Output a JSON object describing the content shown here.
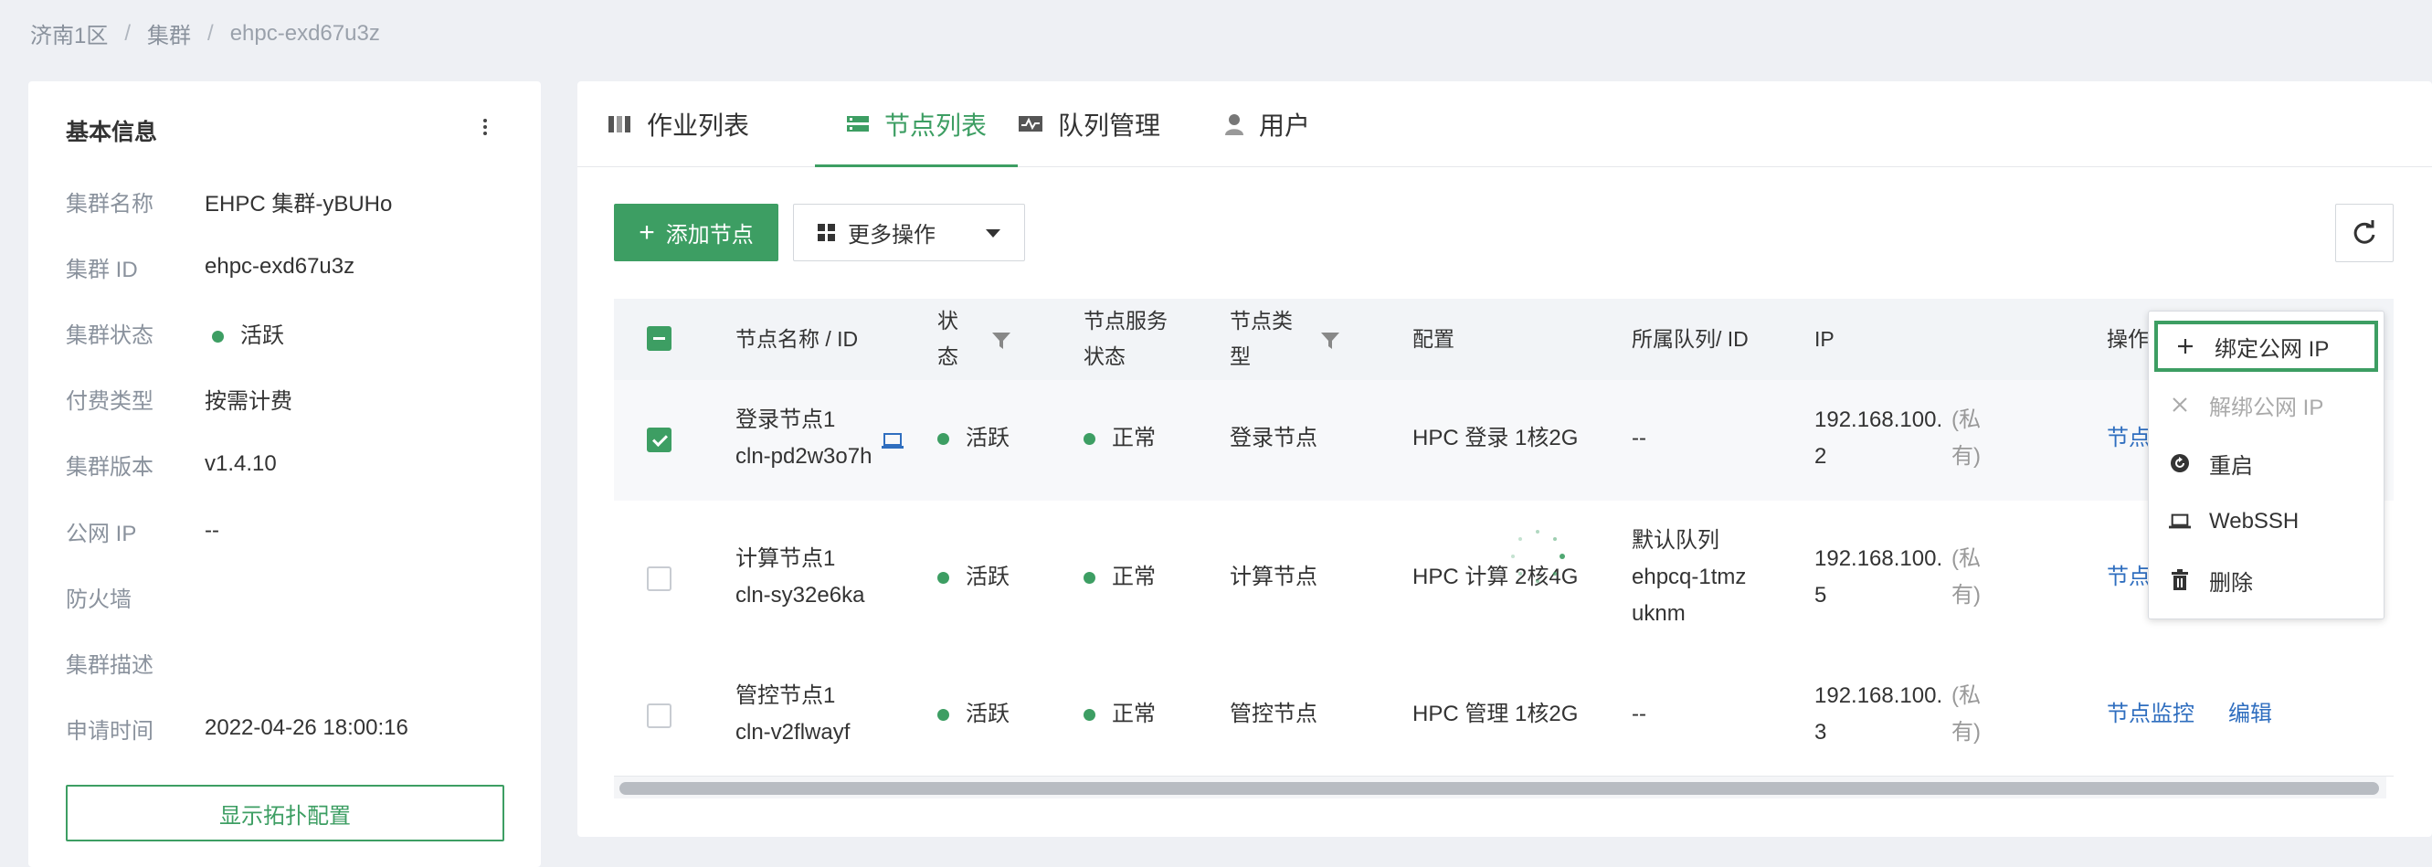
{
  "breadcrumb": [
    "济南1区",
    "集群",
    "ehpc-exd67u3z"
  ],
  "info": {
    "title": "基本信息",
    "rows": [
      {
        "label": "集群名称",
        "value": "EHPC 集群-yBUHo"
      },
      {
        "label": "集群 ID",
        "value": "ehpc-exd67u3z"
      },
      {
        "label": "集群状态",
        "value": "活跃"
      },
      {
        "label": "付费类型",
        "value": "按需计费"
      },
      {
        "label": "集群版本",
        "value": "v1.4.10"
      },
      {
        "label": "公网 IP",
        "value": "--"
      },
      {
        "label": "防火墙",
        "value": ""
      },
      {
        "label": "集群描述",
        "value": ""
      },
      {
        "label": "申请时间",
        "value": "2022-04-26 18:00:16"
      }
    ],
    "topology_button": "显示拓扑配置"
  },
  "tabs": [
    {
      "label": "作业列表",
      "icon": "columns-icon"
    },
    {
      "label": "节点列表",
      "icon": "server-list-icon",
      "active": true
    },
    {
      "label": "队列管理",
      "icon": "queue-monitor-icon"
    },
    {
      "label": "用户",
      "icon": "user-icon"
    }
  ],
  "toolbar": {
    "add_label": "添加节点",
    "more_label": "更多操作"
  },
  "table": {
    "headers": {
      "name": "节点名称 / ID",
      "status": "状态",
      "service_status": "节点服务状态",
      "type": "节点类型",
      "config": "配置",
      "queue": "所属队列/ ID",
      "ip": "IP",
      "actions": "操作"
    },
    "rows": [
      {
        "name": "登录节点1",
        "id": "cln-pd2w3o7h",
        "status": "活跃",
        "service": "正常",
        "type": "登录节点",
        "config": "HPC 登录 1核2G",
        "queue": "--",
        "queue_id": "",
        "ip": "192.168.100.",
        "ip2": "2",
        "ip_note": "(私",
        "ip_note2": "有)",
        "action1": "节点",
        "action2": "",
        "checked": true
      },
      {
        "name": "计算节点1",
        "id": "cln-sy32e6ka",
        "status": "活跃",
        "service": "正常",
        "type": "计算节点",
        "config": "HPC 计算 2核4G",
        "queue": "默认队列",
        "queue_id": "ehpcq-1tmz",
        "queue_id2": "uknm",
        "ip": "192.168.100.",
        "ip2": "5",
        "ip_note": "(私",
        "ip_note2": "有)",
        "action1": "节点",
        "action2": "",
        "checked": false
      },
      {
        "name": "管控节点1",
        "id": "cln-v2flwayf",
        "status": "活跃",
        "service": "正常",
        "type": "管控节点",
        "config": "HPC 管理 1核2G",
        "queue": "--",
        "queue_id": "",
        "ip": "192.168.100.",
        "ip2": "3",
        "ip_note": "(私",
        "ip_note2": "有)",
        "action1": "节点监控",
        "action2": "编辑",
        "checked": false
      }
    ]
  },
  "menu": [
    {
      "label": "绑定公网 IP",
      "icon": "plus-icon"
    },
    {
      "label": "解绑公网 IP",
      "icon": "close-icon",
      "disabled": true
    },
    {
      "label": "重启",
      "icon": "restart-icon"
    },
    {
      "label": "WebSSH",
      "icon": "laptop-icon"
    },
    {
      "label": "删除",
      "icon": "trash-icon"
    }
  ],
  "colors": {
    "accent": "#3d9e63",
    "link": "#2f6ebf"
  }
}
